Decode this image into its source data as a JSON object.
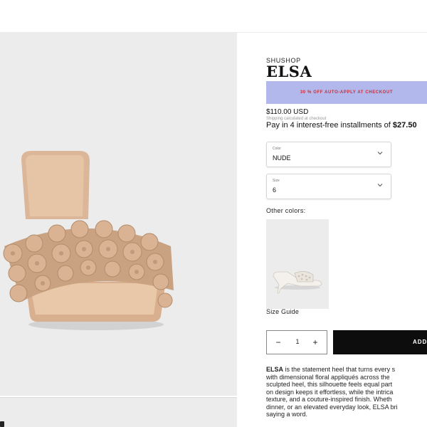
{
  "product": {
    "brand": "SHUSHOP",
    "title": "ELSA",
    "promo": "30 % OFF AUTO-APPLY AT CHECKOUT",
    "price": "$110.00 USD",
    "shipping_note": "Shipping calculated at checkout",
    "installments_prefix": "Pay in 4 interest-free installments of ",
    "installments_amount": "$27.50"
  },
  "options": {
    "color": {
      "label": "Color",
      "value": "NUDE"
    },
    "size": {
      "label": "Size",
      "value": "6"
    }
  },
  "other_colors": {
    "label": "Other colors:"
  },
  "size_guide": "Size Guide",
  "cart": {
    "quantity": "1",
    "minus_symbol": "−",
    "plus_symbol": "+",
    "add_label": "ADD"
  },
  "description": {
    "name": "ELSA",
    "lines": [
      " is the statement heel that turns every s",
      "with dimensional floral appliqués across the",
      "sculpted heel, this silhouette feels equal part",
      "on design keeps it effortless, while the intrica",
      "texture, and a couture-inspired finish. Wheth",
      "dinner, or an elevated everyday look, ELSA bri",
      "saying a word."
    ]
  },
  "colors": {
    "promo_bg": "#b3b8ec",
    "promo_text": "#c0303a",
    "gallery_bg": "#ececec",
    "button_bg": "#0d0d0d"
  },
  "icons": {
    "select_chevron": "chevron-down-icon",
    "qty_minus": "minus-icon",
    "qty_plus": "plus-icon"
  }
}
